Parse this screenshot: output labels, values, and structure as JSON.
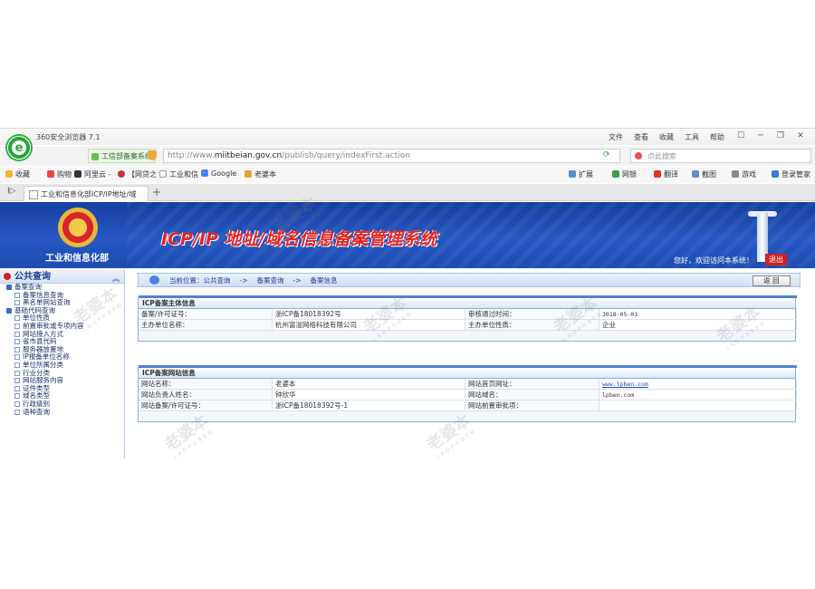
{
  "browser": {
    "app_title": "360安全浏览器 7.1",
    "menu": [
      "文件",
      "查看",
      "收藏",
      "工具",
      "帮助"
    ],
    "site_tag": "工信部备案系统",
    "url_prefix": "http://www.",
    "url_domain": "miitbeian.gov.cn",
    "url_path": "/publish/query/indexFirst.action",
    "search_placeholder": "点此搜索",
    "bookmarks_left": [
      "收藏",
      "购物",
      "阿里云 -",
      "【网贷之",
      "工业和信",
      "Google",
      "老婆本"
    ],
    "bookmarks_right": [
      "扩展",
      "网银",
      "翻译",
      "截图",
      "游戏",
      "登录管家"
    ],
    "tab_title": "工业和信息化部ICP/IP地址/域",
    "logo_glyph": "e"
  },
  "site": {
    "ministry": "工业和信息化部",
    "system_title": "ICP/IP 地址/域名信息备案管理系统",
    "welcome": "您好，欢迎访问本系统！",
    "logout": "退出"
  },
  "sidebar": {
    "title": "公共查询",
    "items": [
      {
        "label": "备案查询",
        "level": 0
      },
      {
        "label": "备案信息查询",
        "level": 1
      },
      {
        "label": "黑名单网站查询",
        "level": 1
      },
      {
        "label": "基础代码查询",
        "level": 0
      },
      {
        "label": "单位性质",
        "level": 1
      },
      {
        "label": "前置审批或专项内容",
        "level": 1
      },
      {
        "label": "网站接入方式",
        "level": 1
      },
      {
        "label": "省市县代码",
        "level": 1
      },
      {
        "label": "服务器放置地",
        "level": 1
      },
      {
        "label": "IP报备单位名称",
        "level": 1
      },
      {
        "label": "单位所属分类",
        "level": 1
      },
      {
        "label": "行业分类",
        "level": 1
      },
      {
        "label": "网站服务内容",
        "level": 1
      },
      {
        "label": "证件类型",
        "level": 1
      },
      {
        "label": "域名类型",
        "level": 1
      },
      {
        "label": "行政级别",
        "level": 1
      },
      {
        "label": "语种查询",
        "level": 1
      }
    ]
  },
  "breadcrumb": {
    "prefix": "当前位置：",
    "items": [
      "公共查询",
      "备案查询",
      "备案信息"
    ],
    "separator": "->"
  },
  "back_button": "返  回",
  "subject_panel": {
    "title": "ICP备案主体信息",
    "rows": [
      [
        "备案/许可证号：",
        "浙ICP备18018392号",
        "审核通过时间：",
        "2018-05-03"
      ],
      [
        "主办单位名称：",
        "杭州富溢网络科技有限公司",
        "主办单位性质：",
        "企业"
      ]
    ]
  },
  "site_panel": {
    "title": "ICP备案网站信息",
    "rows": [
      [
        "网站名称：",
        "老婆本",
        "网站首页网址：",
        "www.lpben.com"
      ],
      [
        "网站负责人姓名：",
        "钟欣华",
        "网站域名：",
        "lpben.com"
      ],
      [
        "网站备案/许可证号：",
        "浙ICP备18018392号-1",
        "网站前置审批项：",
        ""
      ]
    ]
  },
  "watermark": {
    "text": "老婆本",
    "sub": "LAOPOBEN"
  }
}
